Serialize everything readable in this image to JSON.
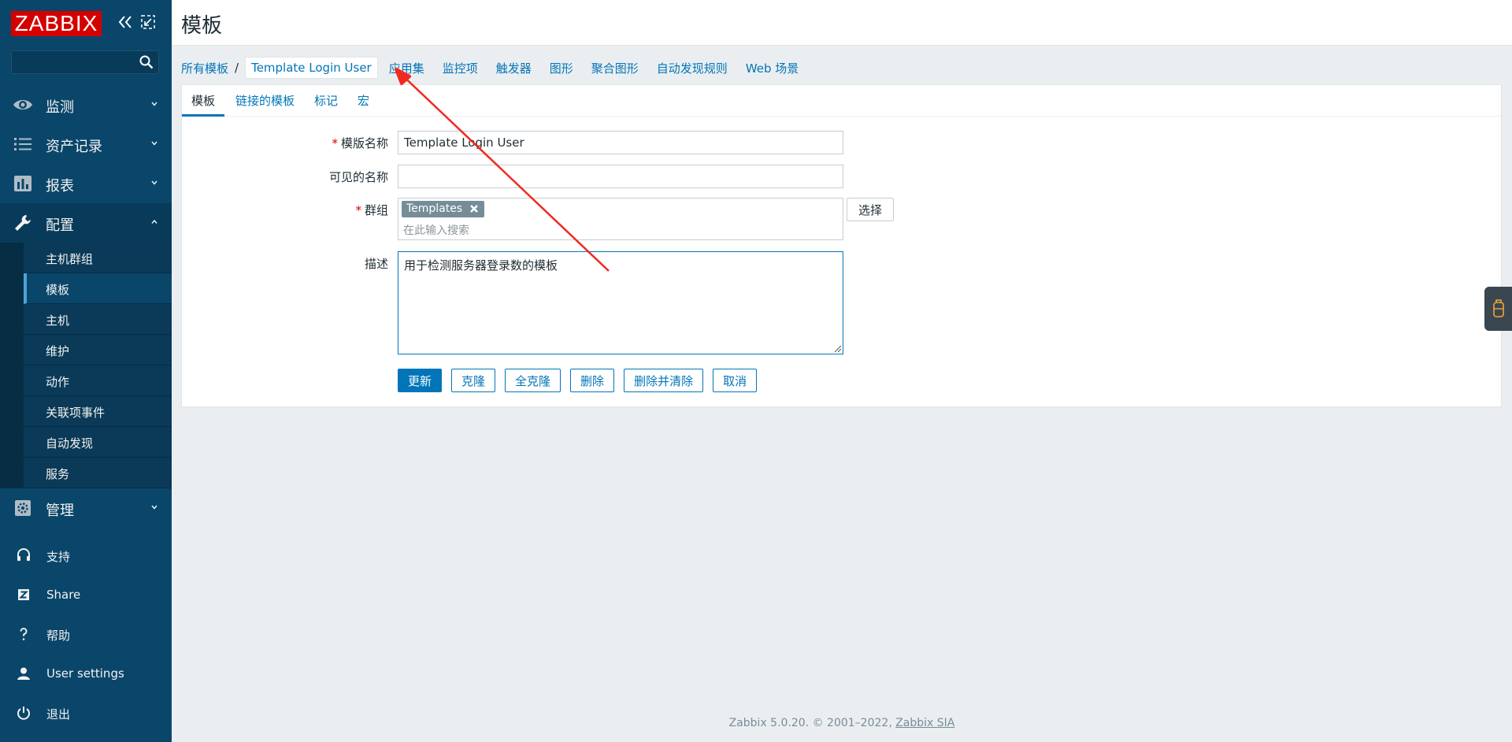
{
  "sidebar": {
    "logo": "ZABBIX",
    "search": {
      "value": "",
      "placeholder": ""
    },
    "menu": [
      {
        "label": "监测",
        "icon": "eye-icon"
      },
      {
        "label": "资产记录",
        "icon": "list-icon"
      },
      {
        "label": "报表",
        "icon": "bar-chart-icon"
      },
      {
        "label": "配置",
        "icon": "wrench-icon"
      }
    ],
    "config_submenu": [
      {
        "label": "主机群组"
      },
      {
        "label": "模板"
      },
      {
        "label": "主机"
      },
      {
        "label": "维护"
      },
      {
        "label": "动作"
      },
      {
        "label": "关联项事件"
      },
      {
        "label": "自动发现"
      },
      {
        "label": "服务"
      }
    ],
    "admin": {
      "label": "管理",
      "icon": "gear-icon"
    },
    "bottom": [
      {
        "label": "支持",
        "icon": "headset-icon"
      },
      {
        "label": "Share",
        "icon": "share-z-icon"
      },
      {
        "label": "帮助",
        "icon": "question-icon"
      },
      {
        "label": "User settings",
        "icon": "user-icon"
      },
      {
        "label": "退出",
        "icon": "power-icon"
      }
    ]
  },
  "header": {
    "title": "模板"
  },
  "nav": {
    "all_templates": "所有模板",
    "separator": "/",
    "current": "Template Login User",
    "links": [
      "应用集",
      "监控项",
      "触发器",
      "图形",
      "聚合图形",
      "自动发现规则",
      "Web 场景"
    ]
  },
  "tabs": [
    "模板",
    "链接的模板",
    "标记",
    "宏"
  ],
  "form": {
    "required_mark": "*",
    "template_name": {
      "label": "模版名称",
      "value": "Template Login User"
    },
    "visible_name": {
      "label": "可见的名称",
      "value": ""
    },
    "groups": {
      "label": "群组",
      "tag": "Templates",
      "placeholder": "在此输入搜索",
      "select_button": "选择"
    },
    "description": {
      "label": "描述",
      "value": "用于检测服务器登录数的模板"
    }
  },
  "buttons": [
    "更新",
    "克隆",
    "全克隆",
    "删除",
    "删除并清除",
    "取消"
  ],
  "footer": {
    "text": "Zabbix 5.0.20. © 2001–2022,",
    "link": "Zabbix SIA"
  },
  "colors": {
    "sidebar": "#0a466a",
    "accent": "#0275b8",
    "logo_red": "#d40000",
    "annotation_arrow": "#f02a20"
  }
}
